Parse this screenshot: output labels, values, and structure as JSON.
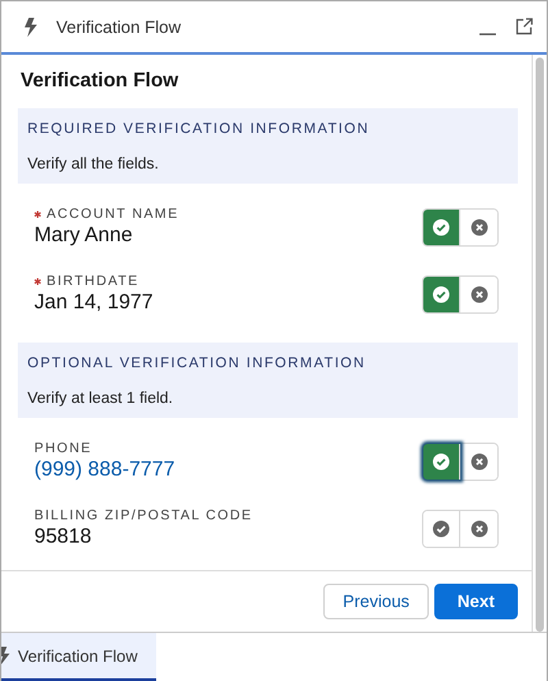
{
  "window": {
    "title": "Verification Flow"
  },
  "page_title": "Verification Flow",
  "sections": [
    {
      "heading": "REQUIRED VERIFICATION INFORMATION",
      "description": "Verify all the fields.",
      "fields": [
        {
          "label": "ACCOUNT NAME",
          "value": "Mary Anne",
          "required": true,
          "kind": "text",
          "verified": true,
          "focused": false
        },
        {
          "label": "BIRTHDATE",
          "value": "Jan 14, 1977",
          "required": true,
          "kind": "text",
          "verified": true,
          "focused": false
        }
      ]
    },
    {
      "heading": "OPTIONAL VERIFICATION INFORMATION",
      "description": "Verify at least 1 field.",
      "fields": [
        {
          "label": "PHONE",
          "value": "(999) 888-7777",
          "required": false,
          "kind": "link",
          "verified": true,
          "focused": true
        },
        {
          "label": "BILLING ZIP/POSTAL CODE",
          "value": "95818",
          "required": false,
          "kind": "text",
          "verified": false,
          "focused": false
        }
      ]
    }
  ],
  "buttons": [
    {
      "label": "Previous",
      "kind": "neutral"
    },
    {
      "label": "Next",
      "kind": "brand"
    }
  ],
  "tabs": [
    {
      "label": "Verification Flow",
      "selected": true
    }
  ]
}
